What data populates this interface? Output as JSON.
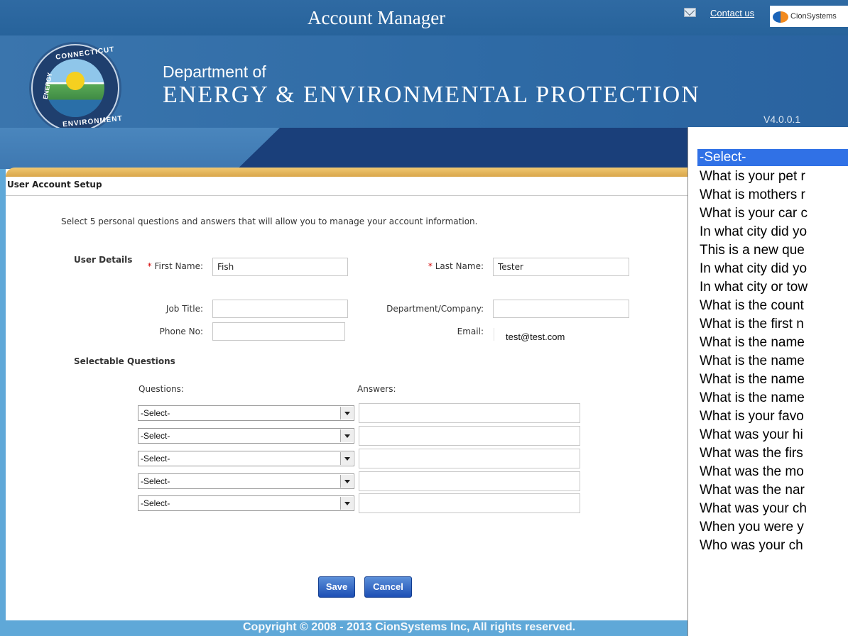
{
  "app_title": "Account Manager",
  "header": {
    "contact_label": "Contact us",
    "vendor_name": "CionSystems",
    "dept_line1": "Department of",
    "dept_line2": "Energy & Environmental Protection",
    "version": "V4.0.0.1",
    "seal_text_top": "CONNECTICUT",
    "seal_text_left": "ENERGY",
    "seal_text_bottom": "ENVIRONMENT"
  },
  "page": {
    "section_title": "User Account Setup",
    "intro": "Select 5 personal questions and answers that will allow you to manage your account information.",
    "user_details_heading": "User Details",
    "selectable_questions_heading": "Selectable Questions",
    "questions_label": "Questions:",
    "answers_label": "Answers:"
  },
  "form": {
    "first_name_label": "First Name:",
    "first_name_value": "Fish",
    "last_name_label": "Last Name:",
    "last_name_value": "Tester",
    "job_title_label": "Job Title:",
    "job_title_value": "",
    "department_label": "Department/Company:",
    "department_value": "",
    "phone_label": "Phone No:",
    "phone_value": "",
    "email_label": "Email:",
    "email_value": "test@test.com",
    "required_marker": "*"
  },
  "questions": [
    {
      "selected": "-Select-",
      "answer": ""
    },
    {
      "selected": "-Select-",
      "answer": ""
    },
    {
      "selected": "-Select-",
      "answer": ""
    },
    {
      "selected": "-Select-",
      "answer": ""
    },
    {
      "selected": "-Select-",
      "answer": ""
    }
  ],
  "buttons": {
    "save": "Save",
    "cancel": "Cancel"
  },
  "footer": "Copyright © 2008 - 2013 CionSystems Inc, All rights reserved.",
  "dropdown_options": [
    "-Select-",
    "What is your pet r",
    "What is mothers r",
    "What is your car c",
    "In what city did yo",
    "This is a new que",
    "In what city did yo",
    "In what city or tow",
    "What is the count",
    "What is the first n",
    "What is the name",
    "What is the name",
    "What is the name",
    "What is the name",
    "What is your favo",
    "What was your hi",
    "What was the firs",
    "What was the mo",
    "What was the nar",
    "What was your ch",
    "When you were y",
    "Who was your ch"
  ],
  "colors": {
    "header_blue": "#2f6aa3",
    "accent_gold": "#d9a64a",
    "button_blue": "#1d4fb5",
    "selection_blue": "#3071e6",
    "required_red": "#d40000"
  }
}
